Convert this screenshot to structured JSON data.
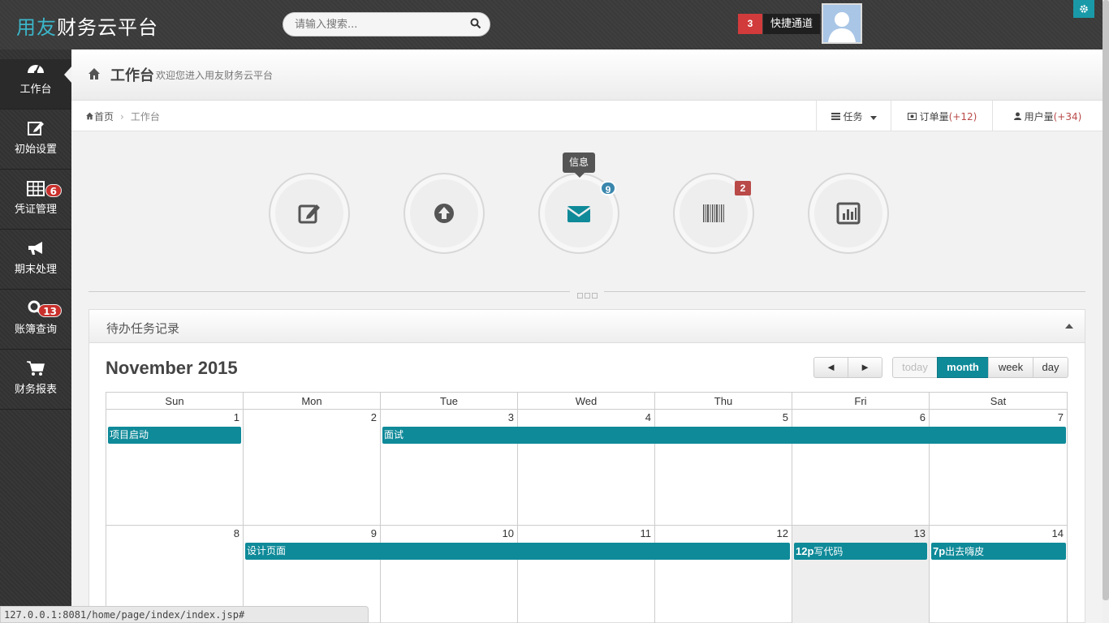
{
  "topbar": {
    "brand_accent": "用友",
    "brand_rest": "财务云平台",
    "search_placeholder": "请输入搜索...",
    "quick_badge": "3",
    "quick_label": "快捷通道"
  },
  "sidebar": {
    "items": [
      {
        "label": "工作台",
        "icon": "dashboard-icon",
        "badge": ""
      },
      {
        "label": "初始设置",
        "icon": "edit-icon",
        "badge": ""
      },
      {
        "label": "凭证管理",
        "icon": "table-icon",
        "badge": "6"
      },
      {
        "label": "期末处理",
        "icon": "bullhorn-icon",
        "badge": ""
      },
      {
        "label": "账簿查询",
        "icon": "search-icon",
        "badge": "13"
      },
      {
        "label": "财务报表",
        "icon": "cart-icon",
        "badge": ""
      }
    ]
  },
  "header": {
    "title": "工作台",
    "subtitle": "欢迎您进入用友财务云平台"
  },
  "breadcrumb": {
    "home": "首页",
    "current": "工作台"
  },
  "stats": {
    "tasks_label": "任务",
    "orders_label": "订单量",
    "orders_delta": "(+12)",
    "users_label": "用户量",
    "users_delta": "(+34)"
  },
  "shortcuts": {
    "tooltip": "信息",
    "mail_badge": "9",
    "barcode_badge": "2",
    "colors": {
      "mail_badge": "#3a87ad",
      "barcode_badge": "#b94a48"
    }
  },
  "panel": {
    "title": "待办任务记录"
  },
  "calendar": {
    "title": "November 2015",
    "prev": "◄",
    "next": "►",
    "today": "today",
    "month": "month",
    "week": "week",
    "day": "day",
    "weekdays": [
      "Sun",
      "Mon",
      "Tue",
      "Wed",
      "Thu",
      "Fri",
      "Sat"
    ],
    "week1": [
      "1",
      "2",
      "3",
      "4",
      "5",
      "6",
      "7"
    ],
    "week2": [
      "8",
      "9",
      "10",
      "11",
      "12",
      "13",
      "14"
    ],
    "events": {
      "e1": "项目启动",
      "e2": "面试",
      "e3": "设计页面",
      "e4_time": "12p",
      "e4": "写代码",
      "e5_time": "7p",
      "e5": "出去嗨皮"
    },
    "accent": "#0f8a99"
  },
  "statusbar": {
    "url": "127.0.0.1:8081/home/page/index/index.jsp#"
  }
}
